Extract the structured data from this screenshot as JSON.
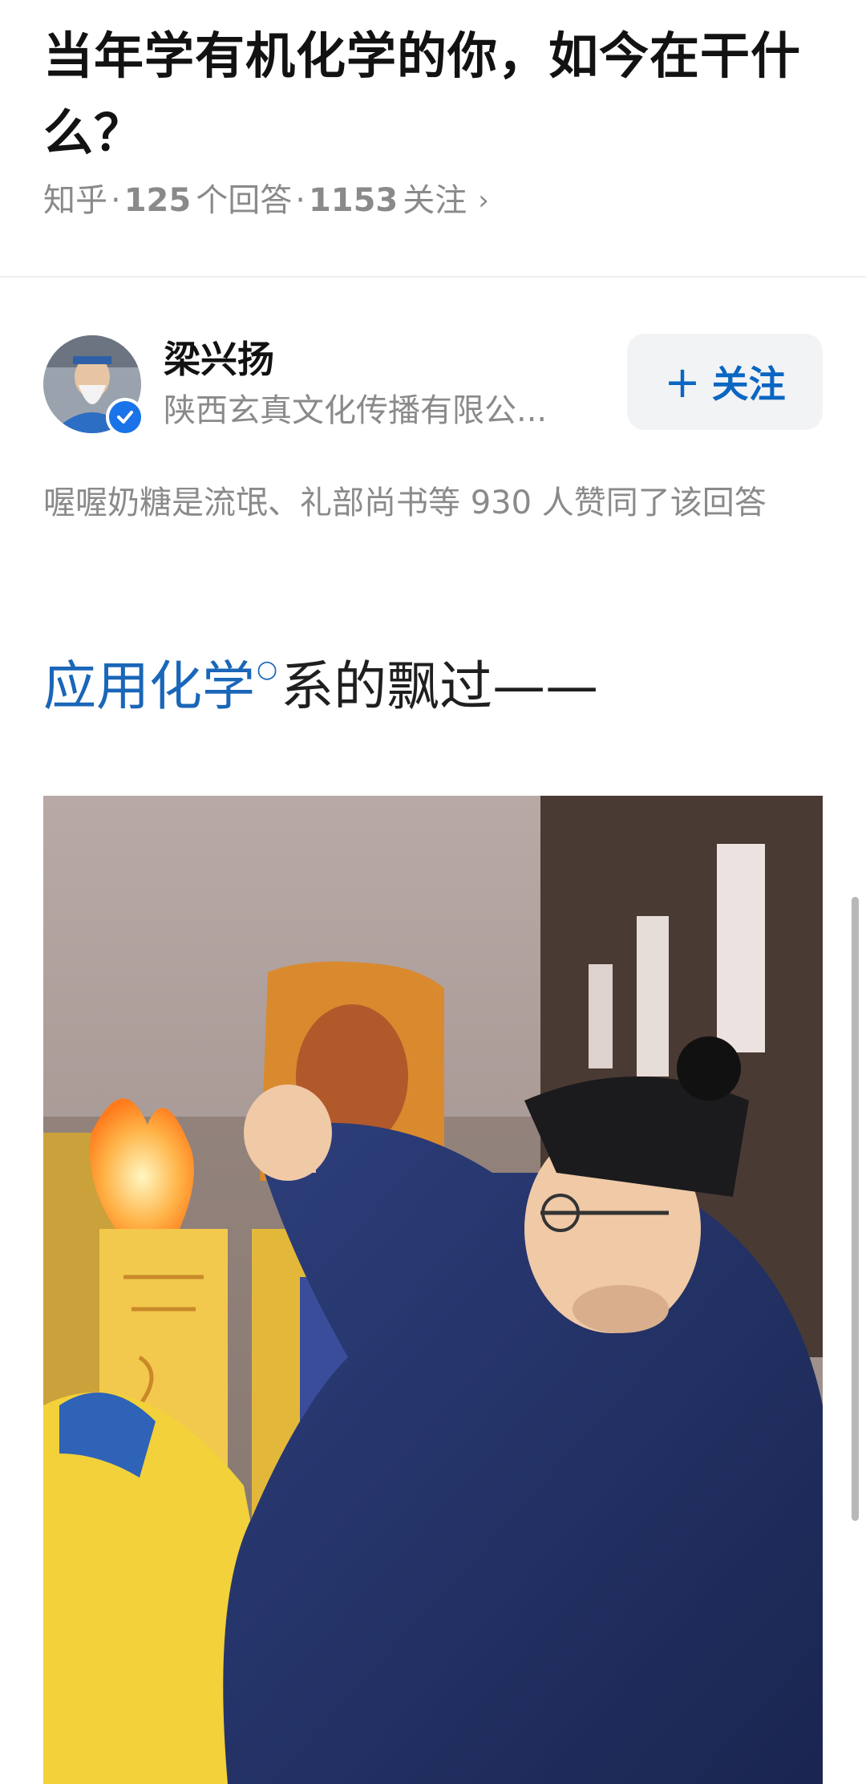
{
  "question": {
    "title": "当年学有机化学的你，如今在干什么？",
    "source": "知乎",
    "answers_count": "125",
    "answers_label": "个回答",
    "follows_count": "1153",
    "follows_label": "关注",
    "chevron": "›"
  },
  "author": {
    "name": "梁兴扬",
    "org": "陕西玄真文化传播有限公...",
    "follow_label": "关注",
    "follow_plus": "+",
    "avatar_icon": "avatar-photo",
    "badge_icon": "verified-check-icon"
  },
  "upvote_text": "喔喔奶糖是流氓、礼部尚书等 930 人赞同了该回答",
  "answer": {
    "link_text": "应用化学",
    "rest_text": "系的飘过——"
  },
  "colors": {
    "link": "#1a66b8",
    "follow_text": "#0a66c2",
    "meta_gray": "#8a8a8a"
  }
}
